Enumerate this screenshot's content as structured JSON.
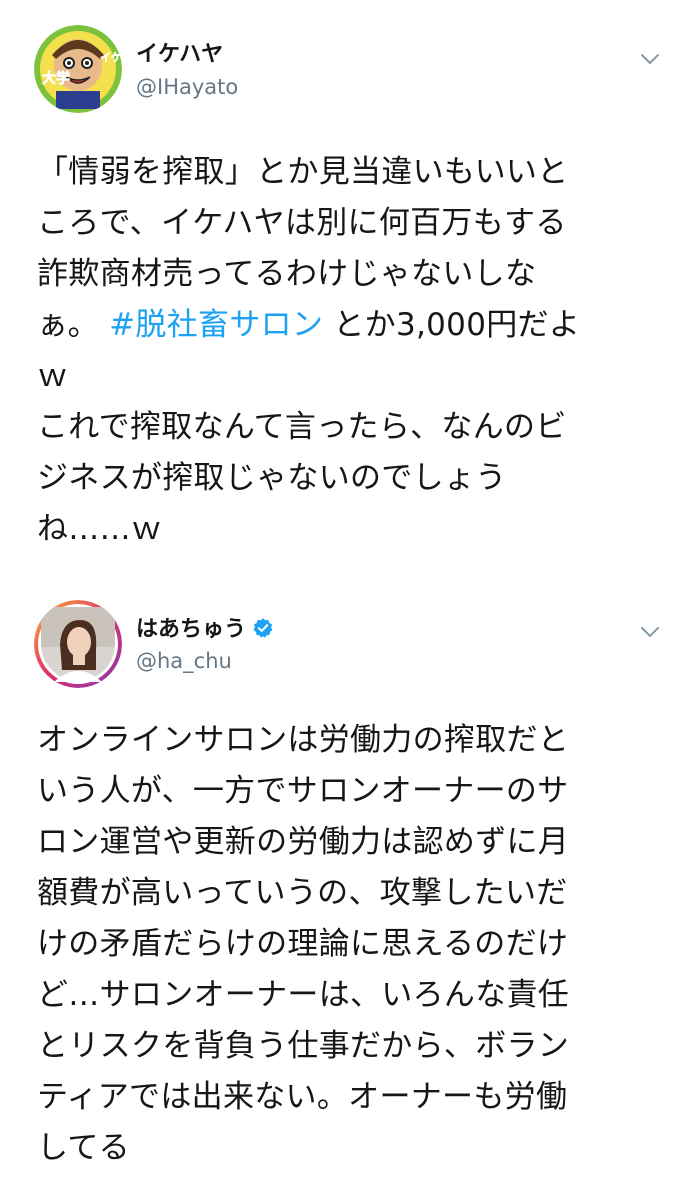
{
  "tweets": [
    {
      "display_name": "イケハヤ",
      "handle": "@IHayato",
      "avatar_icon": "cartoon-avatar-icon",
      "avatar_text": "大学イケハヤ",
      "lines": [
        "「情弱を搾取」とか見当違いもいいと",
        "ころで、イケハヤは別に何百万もする",
        "詐欺商材売ってるわけじゃないしな",
        "ぁ。",
        "とか3,000円だよ",
        "ｗ",
        "これで搾取なんて言ったら、なんのビ",
        "ジネスが搾取じゃないのでしょう",
        "ね……ｗ"
      ],
      "hashtag": "#脱社畜サロン"
    },
    {
      "display_name": "はあちゅう",
      "handle": "@ha_chu",
      "avatar_icon": "photo-avatar-icon",
      "verified_icon": "verified-badge-icon",
      "lines": [
        "オンラインサロンは労働力の搾取だと",
        "いう人が、一方でサロンオーナーのサ",
        "ロン運営や更新の労働力は認めずに月",
        "額費が高いっていうの、攻撃したいだ",
        "けの矛盾だらけの理論に思えるのだけ",
        "ど…サロンオーナーは、いろんな責任",
        "とリスクを背負う仕事だから、ボラン",
        "ティアでは出来ない。オーナーも労働",
        "してる"
      ]
    }
  ],
  "colors": {
    "text": "#14171a",
    "secondary": "#657786",
    "link": "#1da1f2",
    "verified": "#1da1f2"
  }
}
